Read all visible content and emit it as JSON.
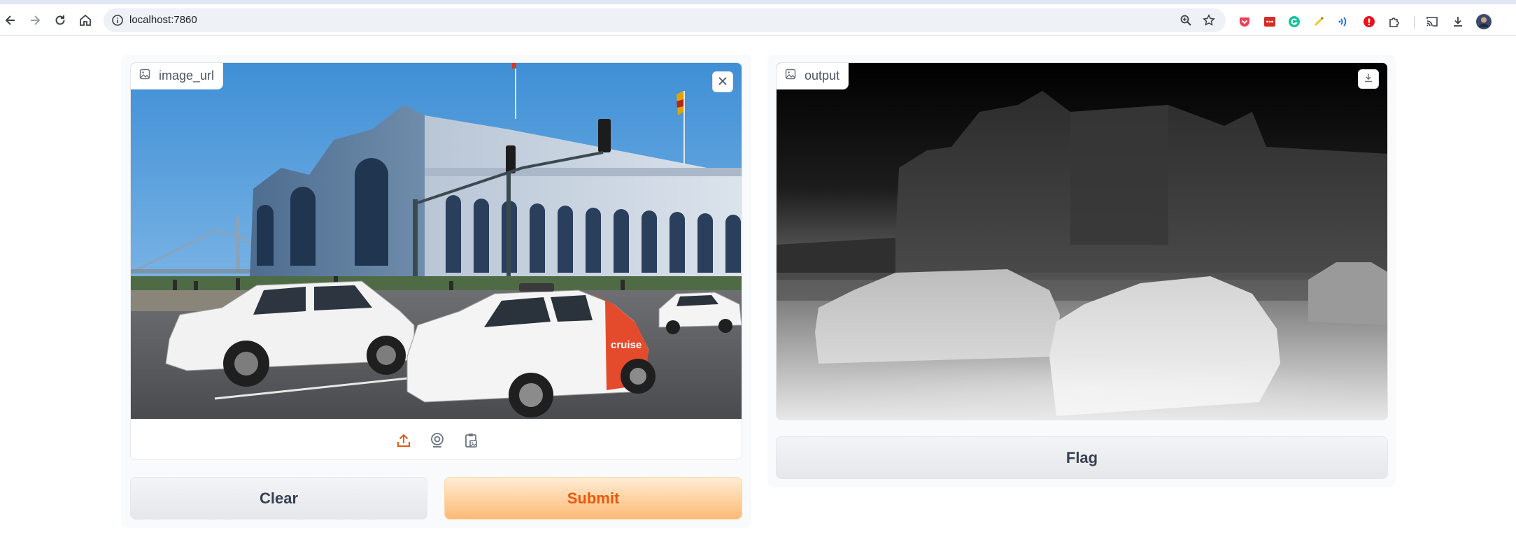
{
  "browser": {
    "url": "localhost:7860",
    "nav_icons": [
      "back-icon",
      "forward-icon",
      "reload-icon",
      "home-icon"
    ],
    "omnibox_icons": [
      "zoom-icon",
      "bookmark-star-icon"
    ],
    "extensions": [
      "pocket-icon",
      "lastpass-icon",
      "grammarly-icon",
      "highlighter-icon",
      "wave-icon",
      "adblock-icon",
      "extensions-puzzle-icon",
      "cast-icon",
      "downloads-icon",
      "profile-avatar"
    ]
  },
  "input_image": {
    "label": "image_url",
    "car_logo_text": "cruise",
    "source_icons": [
      "upload-icon",
      "webcam-icon",
      "clipboard-icon"
    ]
  },
  "output_image": {
    "label": "output"
  },
  "buttons": {
    "clear": "Clear",
    "submit": "Submit",
    "flag": "Flag"
  },
  "colors": {
    "accent": "#ea580c",
    "submit_gradient_top": "#ffedd5",
    "submit_gradient_bottom": "#fdba74",
    "secondary_button": "#e5e7eb"
  }
}
